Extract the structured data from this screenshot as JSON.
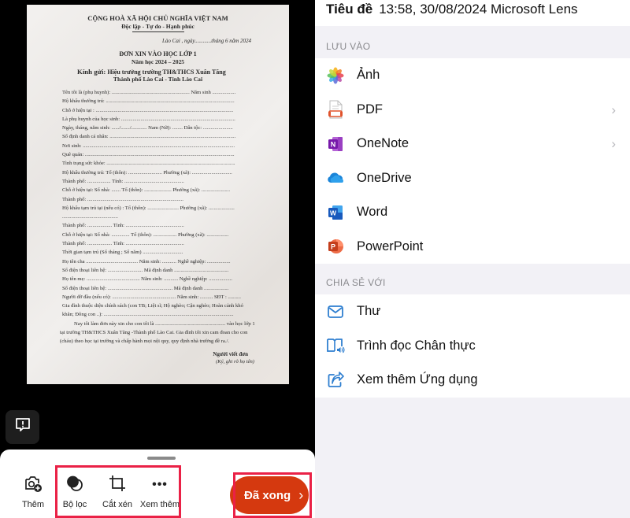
{
  "scan": {
    "document": {
      "header_line1": "CỘNG HOÀ XÃ HỘI CHỦ NGHĨA VIỆT NAM",
      "header_line2": "Độc lập - Tự do - Hạnh phúc",
      "place_date": "Lào Cai , ngày............tháng 6 năm 2024",
      "title": "ĐƠN XIN VÀO HỌC LỚP 1",
      "school_year": "Năm học 2024 – 2025",
      "addressee_label": "Kính gửi:",
      "addressee_line1": "Hiệu trưởng trường TH&THCS Xuân Tăng",
      "addressee_line2": "Thành phố Lào Cai - Tỉnh Lào Cai",
      "fields": [
        "Tên tôi là (phụ huynh): ............................................................ Năm sinh ..................",
        "Hộ khẩu thường trú: ...................................................................................................",
        "Chỗ ở hiện tại : ..........................................................................................................",
        "Là phụ huynh của học sinh: ........................................................................................",
        "Ngày, tháng, năm sinh: ....../......./............ Nam (Nữ): ........ Dân tộc: .......................",
        "Số định danh cá nhân: .................................................................................................",
        "Nơi sinh: .....................................................................................................................",
        "Quê quán: ...................................................................................................................",
        "Tình trạng sức khỏe: ...................................................................................................",
        "Hộ khẩu thường trú: Tổ (thôn): .......................... Phường (xã): ...............................",
        "                             Thành phố: .................. Tỉnh: ..............................................",
        "Chỗ ở hiện tại: Số nhà: ....... Tổ (thôn): ..................... Phường (xã): ......................",
        "                             Thành phố: ..........................................................................",
        "Hộ khẩu tạm trú tại (nếu có) : Tổ (thôn): ........................ Phường (xã): ....................",
        "...........................................",
        "                             Thành phố: ................... Tỉnh: .............................................",
        "Chỗ ở hiện tại: Số nhà: .............. Tổ (thôn): .................. Phường (xã): .................",
        "                             Thành phố: ................... Tỉnh: .............................................",
        "Thời gian tạm trú (Số tháng ; Số năm) ...............................",
        "Họ tên cha ........................................ Năm sinh: ........... Nghề nghiệp: ..................",
        "Số điện thoại liên hệ: ........................... Mã định danh ..........................................",
        "Họ tên mẹ: ......................................... Năm sinh: ........... Nghề nghiệp: ..................",
        "Số điện thoại liên hệ: .................................................. Mã định danh ...................",
        "Người đỡ đầu (nếu có): ................................................. Năm sinh: .......... SĐT : ..........",
        "Gia đình thuộc diện chính sách (con TB; Liệt sĩ; Hộ nghèo; Cận nghèo; Hoàn cảnh khó",
        "khăn; Đông con ..): ...................................................................................................."
      ],
      "paragraph_line1": "Nay tôi làm đơn này xin cho con tôi là ...................................................... vào học lớp 1",
      "paragraph_line2": "tại trường TH&THCS Xuân Tăng -Thành phố Lào Cai. Gia đình tôi xin cam đoan cho con",
      "paragraph_line3": "(cháu) theo học tại trường và chấp hành mọi nội quy, quy định nhà trường đề ra./.",
      "signer": "Người viết đơn",
      "signer_note": "(Ký, ghi rõ họ tên)"
    }
  },
  "toolbar": {
    "add_label": "Thêm",
    "filter_label": "Bộ lọc",
    "crop_label": "Cắt xén",
    "more_label": "Xem thêm",
    "done_label": "Đã xong",
    "done_color": "#d5390f",
    "highlight_color": "#ea2146"
  },
  "save_panel": {
    "title_label": "Tiêu đề",
    "title_value": "13:58, 30/08/2024 Microsoft Lens",
    "save_section": "LƯU VÀO",
    "save_items": [
      {
        "label": "Ảnh",
        "icon": "photos-icon",
        "has_arrow": false
      },
      {
        "label": "PDF",
        "icon": "pdf-icon",
        "has_arrow": true
      },
      {
        "label": "OneNote",
        "icon": "onenote-icon",
        "has_arrow": true
      },
      {
        "label": "OneDrive",
        "icon": "onedrive-icon",
        "has_arrow": false
      },
      {
        "label": "Word",
        "icon": "word-icon",
        "has_arrow": false
      },
      {
        "label": "PowerPoint",
        "icon": "powerpoint-icon",
        "has_arrow": false
      }
    ],
    "share_section": "CHIA SẺ VỚI",
    "share_items": [
      {
        "label": "Thư",
        "icon": "mail-icon"
      },
      {
        "label": "Trình đọc Chân thực",
        "icon": "immersive-reader-icon"
      },
      {
        "label": "Xem thêm Ứng dụng",
        "icon": "share-icon"
      }
    ],
    "accent_color": "#2f7fd0"
  }
}
